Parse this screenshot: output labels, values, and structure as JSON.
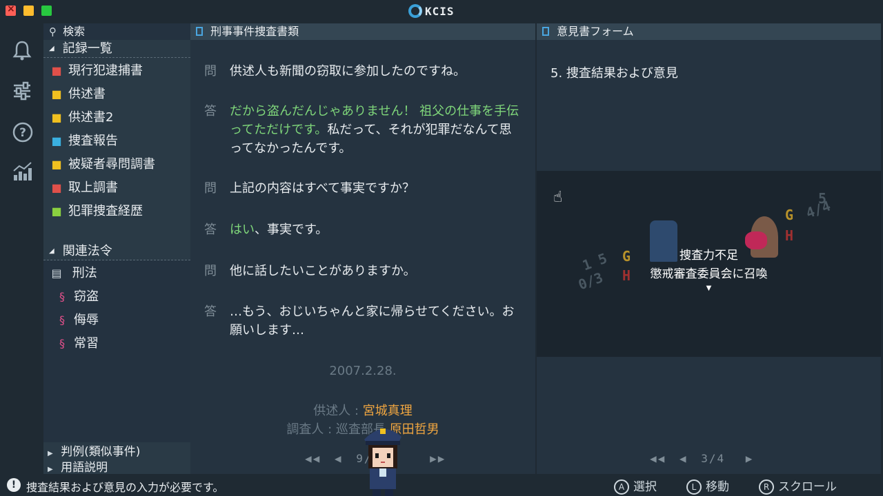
{
  "app": {
    "title": "KCIS"
  },
  "sidebar": {
    "search_label": "検索",
    "records_heading": "記録一覧",
    "records": [
      {
        "label": "現行犯逮捕書",
        "icon": "handcuffs-icon",
        "color": "#e0504a"
      },
      {
        "label": "供述書",
        "icon": "document-icon",
        "color": "#f0c020"
      },
      {
        "label": "供述書2",
        "icon": "document-icon",
        "color": "#f0c020"
      },
      {
        "label": "捜査報告",
        "icon": "pen-icon",
        "color": "#3ab0e0"
      },
      {
        "label": "被疑者尋問調書",
        "icon": "interrogation-icon",
        "color": "#f0c020"
      },
      {
        "label": "取上調書",
        "icon": "magnifier-icon",
        "color": "#e0504a"
      },
      {
        "label": "犯罪捜査経歴",
        "icon": "history-icon",
        "color": "#8ad040"
      }
    ],
    "laws_heading": "関連法令",
    "laws_folder": "刑法",
    "laws": [
      "窃盗",
      "侮辱",
      "常習"
    ],
    "footer_items": [
      "判例(類似事件)",
      "用語説明"
    ]
  },
  "center": {
    "header": "刑事事件捜査書類",
    "qa": [
      {
        "label": "問",
        "parts": [
          {
            "text": "供述人も新聞の窃取に参加したのですね。",
            "green": false
          }
        ]
      },
      {
        "label": "答",
        "parts": [
          {
            "text": "だから盗んだんじゃありません！ 祖父の仕事を手伝ってただけです。",
            "green": true
          },
          {
            "text": "私だって、それが犯罪だなんて思ってなかったんです。",
            "green": false
          }
        ]
      },
      {
        "label": "問",
        "parts": [
          {
            "text": "上記の内容はすべて事実ですか？",
            "green": false
          }
        ]
      },
      {
        "label": "答",
        "parts": [
          {
            "text": "はい",
            "green": true
          },
          {
            "text": "、事実です。",
            "green": false
          }
        ]
      },
      {
        "label": "問",
        "parts": [
          {
            "text": "他に話したいことがありますか。",
            "green": false
          }
        ]
      },
      {
        "label": "答",
        "parts": [
          {
            "text": "…もう、おじいちゃんと家に帰らせてください。お願いします…",
            "green": false
          }
        ]
      }
    ],
    "date": "2007.2.28.",
    "statement_label": "供述人 : ",
    "statement_name": "宮城真理",
    "investigator_label": "調査人 : 巡査部長 ",
    "investigator_name": "原田哲男",
    "page_indicator": "9/"
  },
  "right": {
    "header": "意見書フォーム",
    "form_heading": "5. 捜査結果および意見",
    "scene_line1": "捜査力不足",
    "scene_line2": "懲戒審査委員会に召喚",
    "page_indicator": "3/4"
  },
  "status": {
    "message": "捜査結果および意見の入力が必要です。",
    "hints": [
      {
        "button": "A",
        "label": "選択"
      },
      {
        "button": "L",
        "label": "移動"
      },
      {
        "button": "R",
        "label": "スクロール"
      }
    ]
  },
  "colors": {
    "accent": "#3aa0d8",
    "answer_green": "#7fd67a",
    "name_orange": "#f0a640"
  }
}
